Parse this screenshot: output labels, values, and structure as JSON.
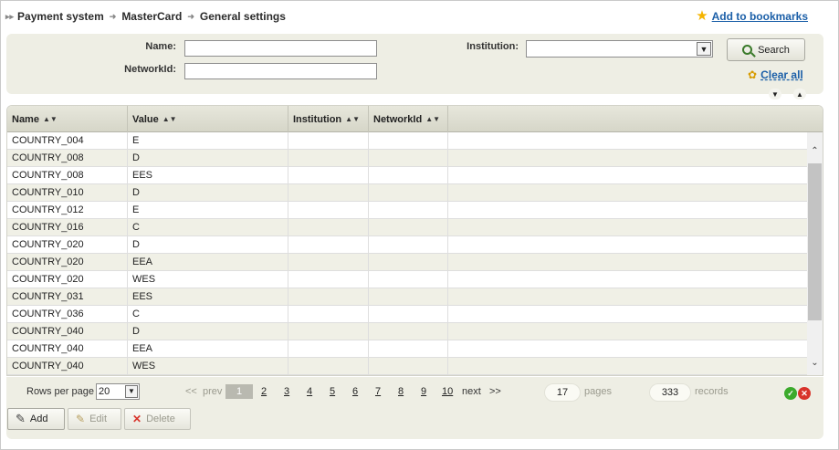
{
  "breadcrumb": [
    "Payment system",
    "MasterCard",
    "General settings"
  ],
  "bookmark_label": "Add to bookmarks",
  "filter": {
    "name_label": "Name:",
    "name_value": "",
    "networkid_label": "NetworkId:",
    "networkid_value": "",
    "institution_label": "Institution:",
    "institution_value": "",
    "search_label": "Search",
    "clear_label": "Clear all"
  },
  "table": {
    "columns": [
      "Name",
      "Value",
      "Institution",
      "NetworkId"
    ],
    "rows": [
      [
        "COUNTRY_004",
        "E",
        "",
        ""
      ],
      [
        "COUNTRY_008",
        "D",
        "",
        ""
      ],
      [
        "COUNTRY_008",
        "EES",
        "",
        ""
      ],
      [
        "COUNTRY_010",
        "D",
        "",
        ""
      ],
      [
        "COUNTRY_012",
        "E",
        "",
        ""
      ],
      [
        "COUNTRY_016",
        "C",
        "",
        ""
      ],
      [
        "COUNTRY_020",
        "D",
        "",
        ""
      ],
      [
        "COUNTRY_020",
        "EEA",
        "",
        ""
      ],
      [
        "COUNTRY_020",
        "WES",
        "",
        ""
      ],
      [
        "COUNTRY_031",
        "EES",
        "",
        ""
      ],
      [
        "COUNTRY_036",
        "C",
        "",
        ""
      ],
      [
        "COUNTRY_040",
        "D",
        "",
        ""
      ],
      [
        "COUNTRY_040",
        "EEA",
        "",
        ""
      ],
      [
        "COUNTRY_040",
        "WES",
        "",
        ""
      ]
    ]
  },
  "pager": {
    "rows_per_page_label": "Rows per page",
    "rows_per_page": "20",
    "first": "<<",
    "prev": "prev",
    "pages": [
      "1",
      "2",
      "3",
      "4",
      "5",
      "6",
      "7",
      "8",
      "9",
      "10"
    ],
    "current_page": "1",
    "next": "next",
    "last": ">>",
    "total_pages": "17",
    "pages_label": "pages",
    "total_records": "333",
    "records_label": "records"
  },
  "actions": {
    "add": "Add",
    "edit": "Edit",
    "delete": "Delete"
  },
  "colors": {
    "panel": "#eeeee4",
    "link": "#1b5fa8",
    "star": "#f5b400"
  }
}
